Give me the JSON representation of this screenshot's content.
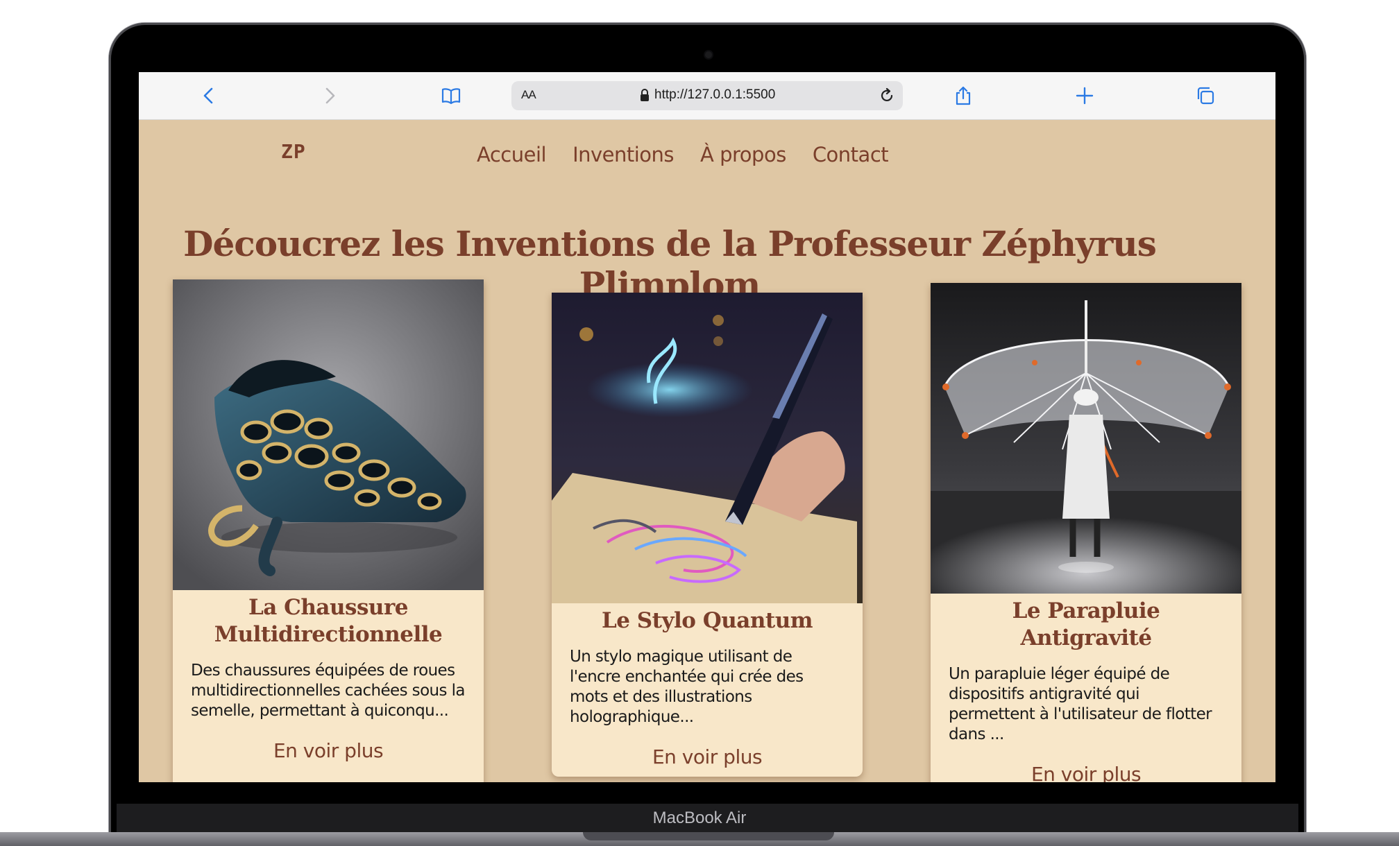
{
  "device": {
    "model_label": "MacBook Air"
  },
  "browser": {
    "text_size_label": "AA",
    "url": "http://127.0.0.1:5500",
    "icons": [
      "back-icon",
      "forward-icon",
      "bookmarks-icon",
      "lock-icon",
      "reload-icon",
      "share-icon",
      "new-tab-icon",
      "tabs-icon"
    ]
  },
  "site": {
    "logo": "ZP",
    "nav": [
      "Accueil",
      "Inventions",
      "À propos",
      "Contact"
    ],
    "title": "Découcrez les Inventions de la Professeur Zéphyrus Plimplom",
    "colors": {
      "background": "#dfc7a4",
      "card": "#f8e7c9",
      "accent": "#7a3f2b"
    },
    "cards": [
      {
        "title": "La Chaussure Multidirectionnelle",
        "description": "Des chaussures équipées de roues multidirectionnelles cachées sous la semelle, permettant à quiconqu...",
        "link": "En voir plus"
      },
      {
        "title": "Le Stylo Quantum",
        "description": "Un stylo magique utilisant de l'encre enchantée qui crée des mots et des illustrations holographique...",
        "link": "En voir plus"
      },
      {
        "title": "Le Parapluie Antigravité",
        "description": "Un parapluie léger équipé de dispositifs antigravité qui permettent à l'utilisateur de flotter dans ...",
        "link": "En voir plus"
      }
    ]
  }
}
